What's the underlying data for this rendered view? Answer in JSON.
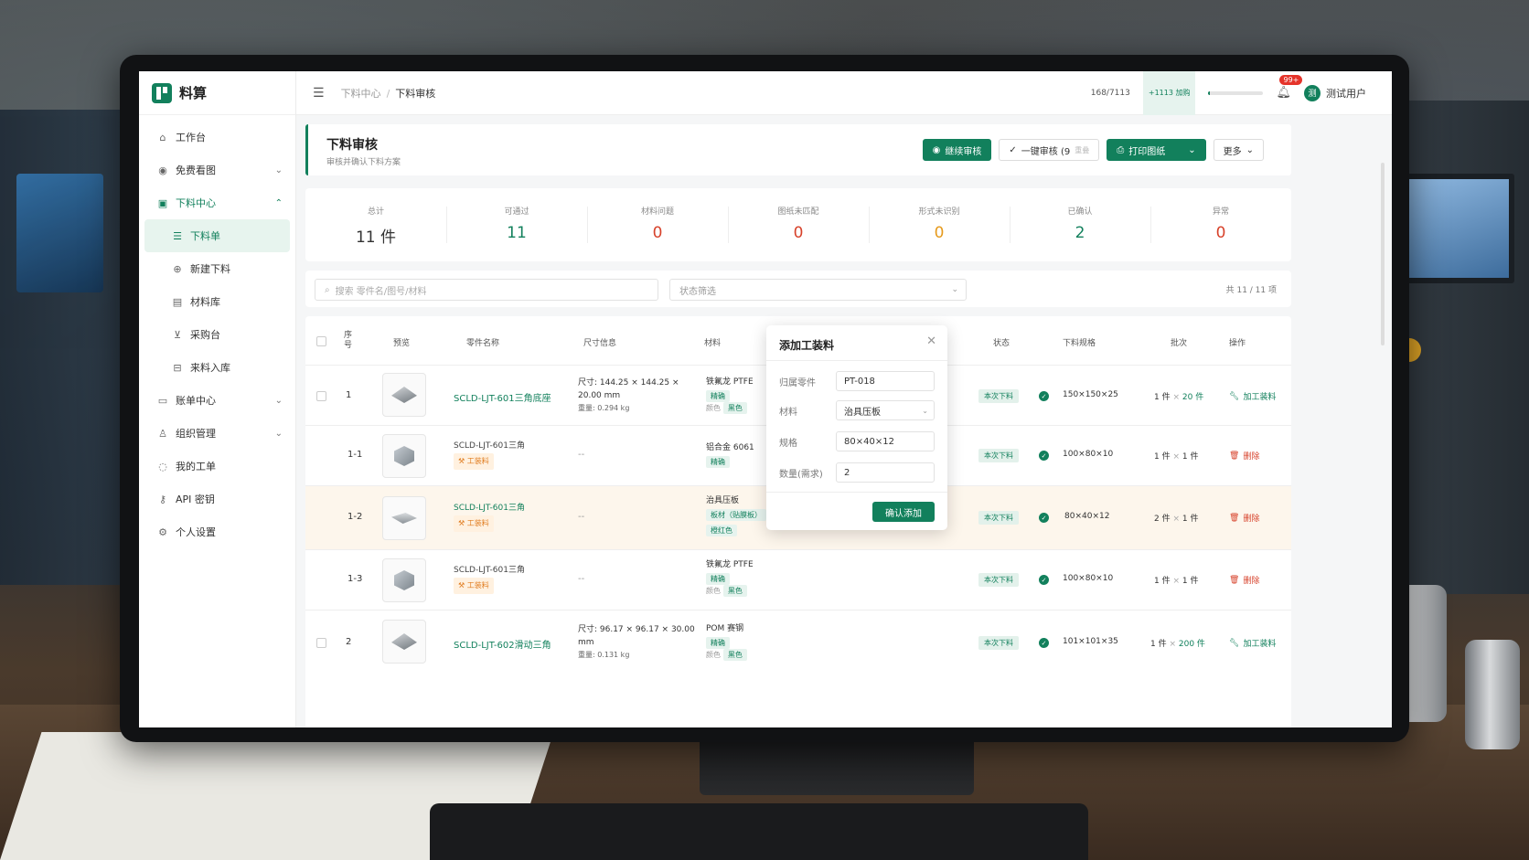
{
  "app": {
    "name": "料算"
  },
  "sidebar": {
    "items": [
      {
        "label": "工作台",
        "icon": "home-icon"
      },
      {
        "label": "免费看图",
        "icon": "eye-icon"
      },
      {
        "label": "下料中心",
        "icon": "grid-icon"
      },
      {
        "label": "下料单",
        "icon": "list-icon"
      },
      {
        "label": "新建下料",
        "icon": "plus-circle-icon"
      },
      {
        "label": "材料库",
        "icon": "book-icon"
      },
      {
        "label": "采购台",
        "icon": "cart-icon"
      },
      {
        "label": "来料入库",
        "icon": "inbox-icon"
      },
      {
        "label": "账单中心",
        "icon": "bill-icon"
      },
      {
        "label": "组织管理",
        "icon": "team-icon"
      },
      {
        "label": "我的工单",
        "icon": "ticket-icon"
      },
      {
        "label": "API 密钥",
        "icon": "key-icon"
      },
      {
        "label": "个人设置",
        "icon": "settings-icon"
      }
    ]
  },
  "topbar": {
    "breadcrumb_parent": "下料中心",
    "breadcrumb_sep": "/",
    "breadcrumb_current": "下料审核",
    "quota": "168/7113",
    "quota_badge": "+1113 加购",
    "quota_progress": 0.024,
    "notif_count": "99+",
    "user_avatar": "测",
    "user_name": "测试用户"
  },
  "header": {
    "title": "下料审核",
    "subtitle": "审核并确认下料方案",
    "btn_continue": "继续审核",
    "btn_batch": "一键审核 (9",
    "btn_batch_hint": "重叠",
    "btn_print": "打印图纸",
    "btn_more": "更多"
  },
  "stats": [
    {
      "label": "总计",
      "value": "11 件",
      "color": "normal"
    },
    {
      "label": "可通过",
      "value": "11",
      "color": "green"
    },
    {
      "label": "材料问题",
      "value": "0",
      "color": "red"
    },
    {
      "label": "图纸未匹配",
      "value": "0",
      "color": "red"
    },
    {
      "label": "形式未识别",
      "value": "0",
      "color": "orange"
    },
    {
      "label": "已确认",
      "value": "2",
      "color": "green"
    },
    {
      "label": "异常",
      "value": "0",
      "color": "red"
    }
  ],
  "filter": {
    "search_placeholder": "搜索 零件名/图号/材料",
    "status_placeholder": "状态筛选",
    "count": "共 11 / 11 项"
  },
  "table": {
    "headers": {
      "seq": "序号",
      "preview": "预览",
      "name": "零件名称",
      "size": "尺寸信息",
      "material": "材料",
      "status": "状态",
      "spec": "下料规格",
      "batch": "批次",
      "ops": "操作"
    },
    "rows": [
      {
        "seq": "1",
        "name": "SCLD-LJT-601三角底座",
        "tooling": "",
        "size1": "尺寸: 144.25 × 144.25 ×",
        "size2": "20.00 mm",
        "weight": "重量:  0.294 kg",
        "mat": "铁氟龙 PTFE",
        "mat_tag": "精确",
        "color_label": "颜色",
        "color_tag": "黑色",
        "status": "本次下料",
        "spec": "150×150×25",
        "batch_a": "1 件",
        "batch_b": "20 件",
        "op": "加工装料"
      },
      {
        "seq": "1-1",
        "name": "SCLD-LJT-601三角",
        "tooling": "工装料",
        "size1": "--",
        "mat": "铝合金 6061",
        "mat_tag": "精确",
        "status": "本次下料",
        "spec": "100×80×10",
        "batch_a": "1 件",
        "batch_b": "1 件",
        "op": "删除"
      },
      {
        "seq": "1-2",
        "name": "SCLD-LJT-601三角",
        "tooling": "工装料",
        "size1": "--",
        "mat": "治具压板",
        "mat_tag": "板材（贴膜板）",
        "mat_tag2": "橙红色",
        "status": "本次下料",
        "spec": "80×40×12",
        "batch_a": "2 件",
        "batch_b": "1 件",
        "op": "删除"
      },
      {
        "seq": "1-3",
        "name": "SCLD-LJT-601三角",
        "tooling": "工装料",
        "size1": "--",
        "mat": "铁氟龙 PTFE",
        "mat_tag": "精确",
        "color_label": "颜色",
        "color_tag": "黑色",
        "status": "本次下料",
        "spec": "100×80×10",
        "batch_a": "1 件",
        "batch_b": "1 件",
        "op": "删除"
      },
      {
        "seq": "2",
        "name": "SCLD-LJT-602滑动三角",
        "tooling": "",
        "size1": "尺寸: 96.17 × 96.17 × 30.00",
        "size2": "mm",
        "weight": "重量:  0.131 kg",
        "mat": "POM 赛钢",
        "mat_tag": "精确",
        "color_label": "颜色",
        "color_tag": "黑色",
        "status": "本次下料",
        "spec": "101×101×35",
        "batch_a": "1 件",
        "batch_b": "200 件",
        "op": "加工装料"
      }
    ],
    "multiply": "×"
  },
  "modal": {
    "title": "添加工装料",
    "close_icon": "close-icon",
    "f1_label": "归属零件",
    "f1_value": "PT-018",
    "f2_label": "材料",
    "f2_value": "治具压板",
    "f3_label": "规格",
    "f3_value": "80×40×12",
    "f4_label": "数量(需求)",
    "f4_value": "2",
    "confirm": "确认添加"
  },
  "colors": {
    "accent": "#12805c",
    "danger": "#d7422b",
    "warning": "#e69a1c"
  }
}
